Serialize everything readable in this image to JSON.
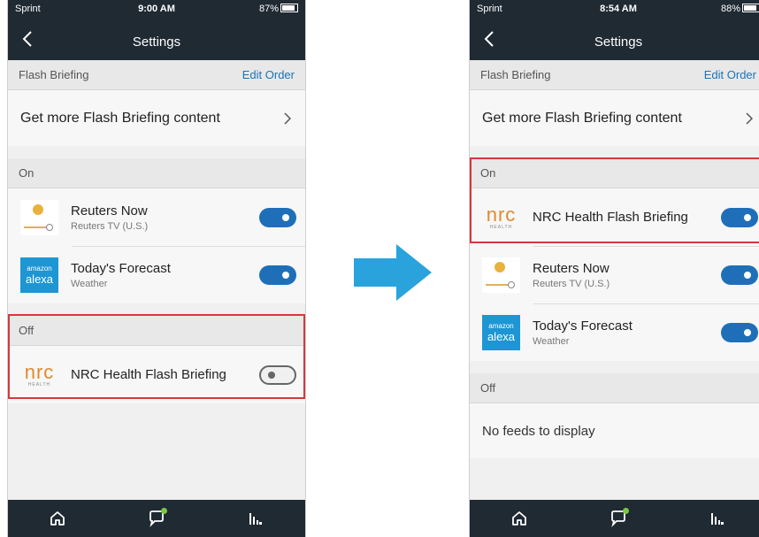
{
  "left": {
    "status": {
      "carrier": "Sprint",
      "time": "9:00 AM",
      "battery": "87%"
    },
    "header": {
      "title": "Settings"
    },
    "flash_section": {
      "label": "Flash Briefing",
      "edit_label": "Edit Order"
    },
    "get_more": "Get more Flash Briefing content",
    "on_label": "On",
    "on_feeds": [
      {
        "name": "Reuters Now",
        "sub": "Reuters TV (U.S.)",
        "enabled": true
      },
      {
        "name": "Today's Forecast",
        "sub": "Weather",
        "enabled": true
      }
    ],
    "off_label": "Off",
    "off_feeds": [
      {
        "name": "NRC Health Flash Briefing",
        "enabled": false
      }
    ]
  },
  "right": {
    "status": {
      "carrier": "Sprint",
      "time": "8:54 AM",
      "battery": "88%"
    },
    "header": {
      "title": "Settings"
    },
    "flash_section": {
      "label": "Flash Briefing",
      "edit_label": "Edit Order"
    },
    "get_more": "Get more Flash Briefing content",
    "on_label": "On",
    "on_feeds": [
      {
        "name": "NRC Health Flash Briefing",
        "enabled": true
      },
      {
        "name": "Reuters Now",
        "sub": "Reuters TV (U.S.)",
        "enabled": true
      },
      {
        "name": "Today's Forecast",
        "sub": "Weather",
        "enabled": true
      }
    ],
    "off_label": "Off",
    "empty_text": "No feeds to display"
  },
  "logos": {
    "alexa_top": "amazon",
    "alexa_bottom": "alexa",
    "nrc_main": "nrc",
    "nrc_sub": "HEALTH"
  },
  "icons": {
    "back": "chevron-left-icon",
    "chevron": "chevron-right-icon",
    "home": "home-icon",
    "chat": "chat-bubble-icon",
    "music": "equalizer-icon",
    "arrow": "right-arrow-icon"
  },
  "colors": {
    "header_bg": "#1f2a33",
    "accent_blue": "#1e6fb8",
    "link_blue": "#1a73b8",
    "highlight_red": "#d6383d",
    "arrow_blue": "#2aa3dc",
    "nrc_orange": "#e08a2e"
  }
}
